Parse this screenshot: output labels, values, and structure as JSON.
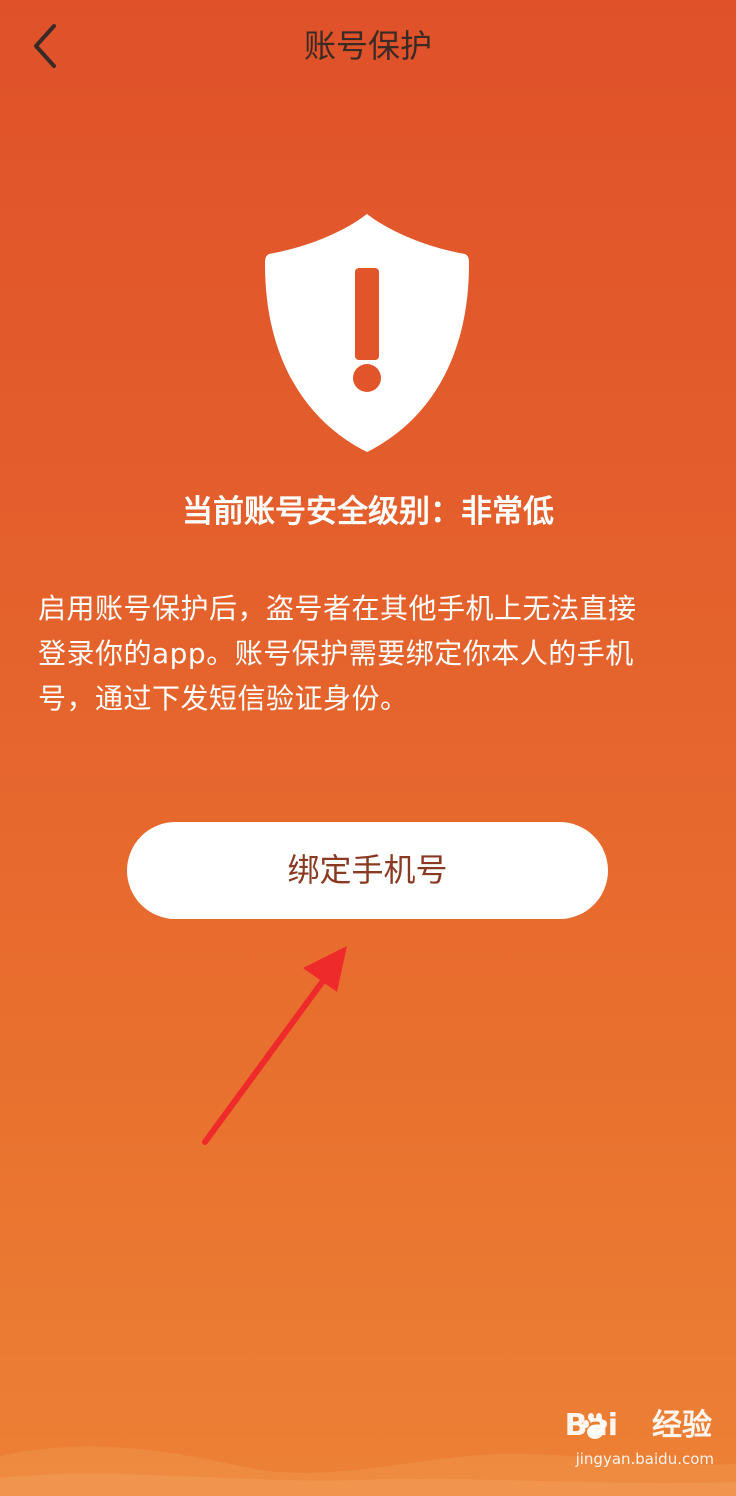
{
  "header": {
    "title": "账号保护",
    "back_icon": "chevron-left-icon"
  },
  "main": {
    "shield_icon": "shield-alert-icon",
    "security_level_text": "当前账号安全级别：非常低",
    "description_lines": [
      "启用账号保护后，盗号者在其他手机上无法直接",
      "登录你的app。账号保护需要绑定你本人的手机",
      "号，通过下发短信验证身份。"
    ],
    "bind_button_label": "绑定手机号"
  },
  "annotation": {
    "arrow_icon": "red-arrow-annotation",
    "color": "#ee2a2a"
  },
  "watermark": {
    "logo_left": "Bai",
    "logo_right": "经验",
    "url": "jingyan.baidu.com"
  },
  "colors": {
    "background_top": "#e0512a",
    "background_bottom": "#ec8135",
    "button_bg": "#ffffff",
    "button_text": "#8a3a22",
    "title_text": "#3a2a25"
  }
}
